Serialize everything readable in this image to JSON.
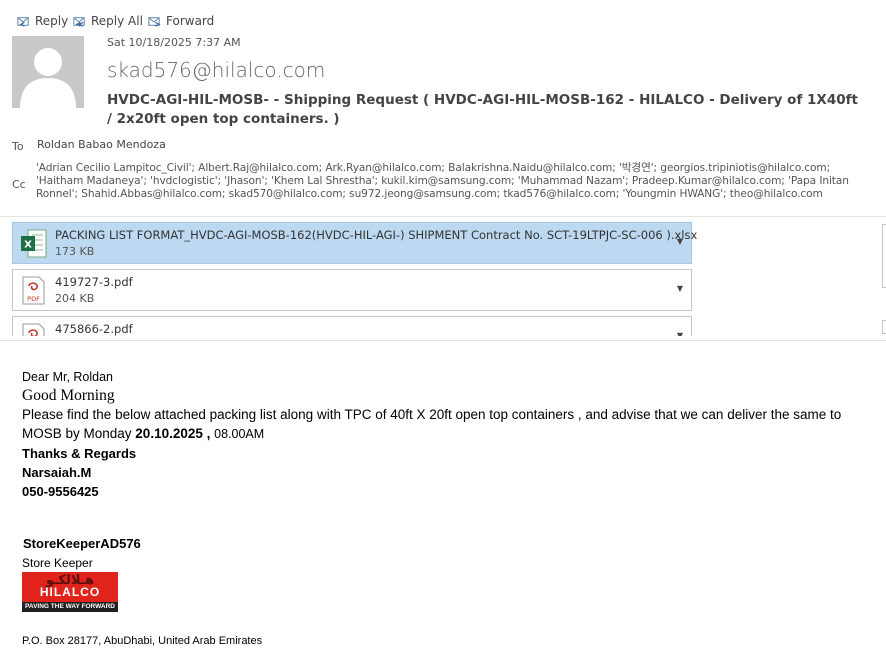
{
  "toolbar": {
    "reply": "Reply",
    "reply_all": "Reply All",
    "forward": "Forward"
  },
  "header": {
    "date": "Sat 10/18/2025 7:37 AM",
    "sender": "skad576@hilalco.com",
    "subject": "HVDC-AGI-HIL-MOSB- - Shipping Request ( HVDC-AGI-HIL-MOSB-162 - HILALCO - Delivery of   1X40ft / 2x20ft open top containers.   )",
    "to_label": "To",
    "to": "Roldan Babao Mendoza",
    "cc_label": "Cc",
    "cc": "'Adrian Cecilio Lampitoc_Civil'; Albert.Raj@hilalco.com; Ark.Ryan@hilalco.com; Balakrishna.Naidu@hilalco.com; '박경연'; georgios.tripiniotis@hilalco.com; 'Haitham Madaneya'; 'hvdclogistic'; 'Jhason'; 'Khem Lal Shrestha'; kukil.kim@samsung.com; 'Muhammad Nazam'; Pradeep.Kumar@hilalco.com; 'Papa Initan Ronnel'; Shahid.Abbas@hilalco.com; skad570@hilalco.com; su972.jeong@samsung.com; tkad576@hilalco.com; 'Youngmin HWANG'; theo@hilalco.com"
  },
  "attachments": [
    {
      "name": "PACKING LIST FORMAT_HVDC-AGI-MOSB-162(HVDC-HIL-AGI-)  SHIPMENT Contract No. SCT-19LTPJC-SC-006 ).xlsx",
      "size": "173 KB",
      "icon": "excel-icon",
      "selected": true
    },
    {
      "name": "419727-3.pdf",
      "size": "204 KB",
      "icon": "pdf-icon",
      "selected": false
    },
    {
      "name": "475866-2.pdf",
      "size": "",
      "icon": "pdf-icon",
      "selected": false
    }
  ],
  "body": {
    "greeting": "Dear Mr, Roldan",
    "good_morning": "Good Morning",
    "line1": " Please find the below attached packing list  along with TPC of  40ft X 20ft open top containers   ,  and advise that we can deliver the same to  MOSB  by Monday  ",
    "date_bold": " 20.10.2025  , ",
    "time": "08.00AM",
    "regards": "Thanks & Regards",
    "name": "Narsaiah.M",
    "phone": "050-9556425",
    "sig_name": "StoreKeeperAD576",
    "sig_title": "Store Keeper",
    "address": "P.O. Box 28177, AbuDhabi, United Arab Emirates"
  },
  "logo": {
    "arabic": "هـلالكـو",
    "brand": "HILALCO",
    "tagline": "PAVING THE WAY FORWARD"
  },
  "colors": {
    "selected_attachment": "#bcd9f1",
    "logo_red": "#e0231b",
    "excel_green": "#1e7145",
    "pdf_red": "#c0392b"
  }
}
